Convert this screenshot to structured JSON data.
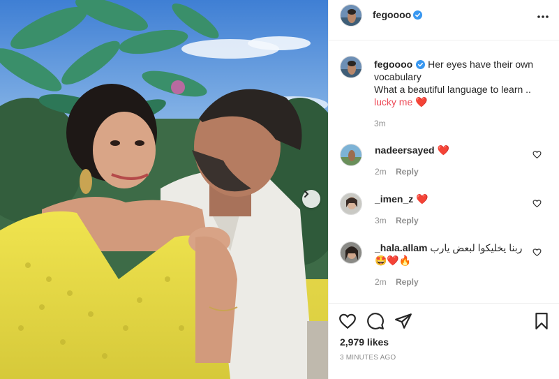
{
  "post": {
    "username": "fegoooo",
    "caption_lines": [
      "Her eyes have their own",
      "vocabulary",
      "What a beautiful language to learn ..",
      "lucky me ❤️"
    ],
    "caption_time": "3m",
    "likes": "2,979 likes",
    "posted_ago": "3 MINUTES AGO"
  },
  "comments": [
    {
      "username": "nadeersayed",
      "text": "❤️",
      "time": "2m",
      "reply_label": "Reply"
    },
    {
      "username": "_imen_z",
      "text": "❤️",
      "time": "3m",
      "reply_label": "Reply"
    },
    {
      "username": "_hala.allam",
      "text": "ربنا يخليكوا لبعض يارب",
      "text2": "🤩❤️🔥",
      "time": "2m",
      "reply_label": "Reply"
    }
  ],
  "icons": {
    "verified": "verified-badge-icon",
    "more": "more-options-icon",
    "like": "heart-icon",
    "comment": "comment-icon",
    "share": "paper-plane-icon",
    "save": "bookmark-icon",
    "next": "chevron-right-icon"
  },
  "colors": {
    "verified_blue": "#3897f0",
    "heart_red": "#ed4956",
    "muted_text": "#8e8e8e"
  }
}
